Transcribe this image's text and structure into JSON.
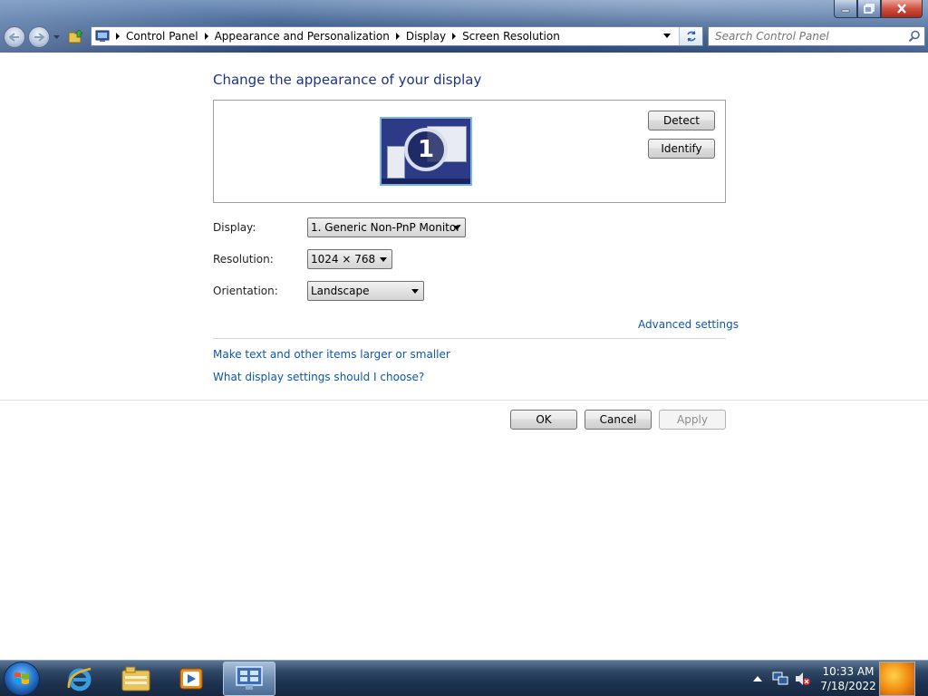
{
  "window": {
    "controls": [
      "minimize-icon",
      "maximize-icon",
      "close-icon"
    ]
  },
  "address": {
    "crumbs": [
      "Control Panel",
      "Appearance and Personalization",
      "Display",
      "Screen Resolution"
    ]
  },
  "search": {
    "placeholder": "Search Control Panel"
  },
  "main": {
    "title": "Change the appearance of your display",
    "monitor_number": "1",
    "detect_label": "Detect",
    "identify_label": "Identify",
    "display_label": "Display:",
    "display_value": "1. Generic Non-PnP Monitor",
    "resolution_label": "Resolution:",
    "resolution_value": "1024 × 768",
    "orientation_label": "Orientation:",
    "orientation_value": "Landscape",
    "advanced_link": "Advanced settings",
    "text_size_link": "Make text and other items larger or smaller",
    "help_link": "What display settings should I choose?"
  },
  "footer": {
    "ok_label": "OK",
    "cancel_label": "Cancel",
    "apply_label": "Apply"
  },
  "taskbar": {
    "time": "10:33 AM",
    "date": "7/18/2022",
    "pinned": [
      "internet-explorer-icon",
      "windows-explorer-icon",
      "media-player-icon",
      "control-panel-icon"
    ],
    "tray": [
      "show-hidden-icons-icon",
      "network-icon",
      "volume-muted-icon"
    ]
  },
  "colors": {
    "title": "#1e3287",
    "link": "#0d57a6"
  }
}
